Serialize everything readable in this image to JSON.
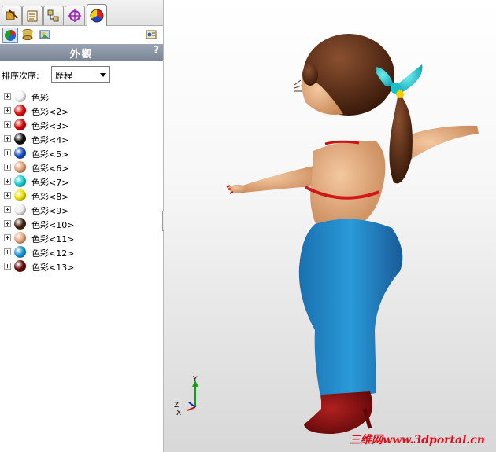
{
  "panel": {
    "tabs": [
      "feature-manager-icon",
      "property-manager-icon",
      "configuration-manager-icon",
      "dimxpert-icon",
      "appearance-icon"
    ],
    "sub_icons": [
      "color-appearance-icon",
      "scene-icon",
      "decals-icon",
      "display-state-icon"
    ],
    "header": {
      "title": "外觀",
      "help": "?"
    },
    "sort": {
      "label": "排序次序:",
      "value": "歷程"
    },
    "items": [
      {
        "label": "色彩",
        "color": "#f4f4f4"
      },
      {
        "label": "色彩<2>",
        "color": "#e01010"
      },
      {
        "label": "色彩<3>",
        "color": "#d80808"
      },
      {
        "label": "色彩<4>",
        "color": "#101010"
      },
      {
        "label": "色彩<5>",
        "color": "#1a50c8"
      },
      {
        "label": "色彩<6>",
        "color": "#e8a078"
      },
      {
        "label": "色彩<7>",
        "color": "#18d0d8"
      },
      {
        "label": "色彩<8>",
        "color": "#f0e000"
      },
      {
        "label": "色彩<9>",
        "color": "#eeeeee"
      },
      {
        "label": "色彩<10>",
        "color": "#4a2410"
      },
      {
        "label": "色彩<11>",
        "color": "#e8a880"
      },
      {
        "label": "色彩<12>",
        "color": "#1898d8"
      },
      {
        "label": "色彩<13>",
        "color": "#6a0808"
      }
    ]
  },
  "viewport": {
    "triad": {
      "x": "X",
      "y": "Y",
      "z": "Z"
    },
    "watermark": "三维网www.3dportal.cn"
  }
}
